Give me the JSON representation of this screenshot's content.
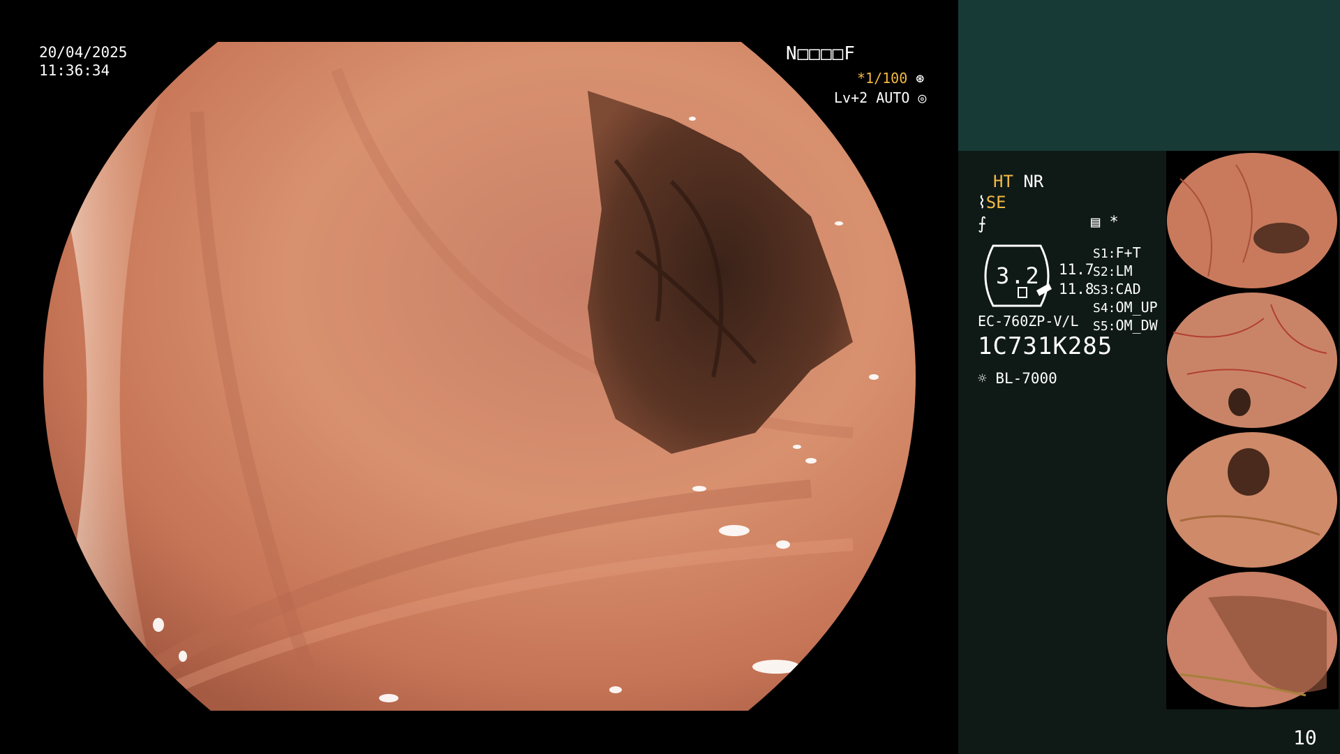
{
  "overlay": {
    "date": "20/04/2025",
    "time": "11:36:34",
    "mode_label": "N□□□□F",
    "shutter": "*1/100",
    "shutter_icon": "⊛",
    "level": "Lv+2 AUTO",
    "level_icon": "◎"
  },
  "panel": {
    "ht": "HT",
    "nr": "NR",
    "se": "SE",
    "se_icon": "⌇",
    "edge_icon": "⨍",
    "menu_icon": "▤",
    "star": "*",
    "zoom_value": "3.2",
    "value_1": "11.7",
    "value_2": "11.8",
    "settings": [
      {
        "key": "S1:",
        "value": "F+T"
      },
      {
        "key": "S2:",
        "value": "LM"
      },
      {
        "key": "S3:",
        "value": "CAD"
      },
      {
        "key": "S4:",
        "value": "OM_UP"
      },
      {
        "key": "S5:",
        "value": "OM_DW"
      }
    ],
    "scope_model": "EC-760ZP-V/L",
    "serial": "1C731K285",
    "light_icon": "☼",
    "light_source": "BL-7000",
    "page_number": "10"
  },
  "colors": {
    "panel_bg": "#0f1a17",
    "panel_top": "#173a36",
    "accent": "#f4b943",
    "mucosa": "#d4876a"
  }
}
